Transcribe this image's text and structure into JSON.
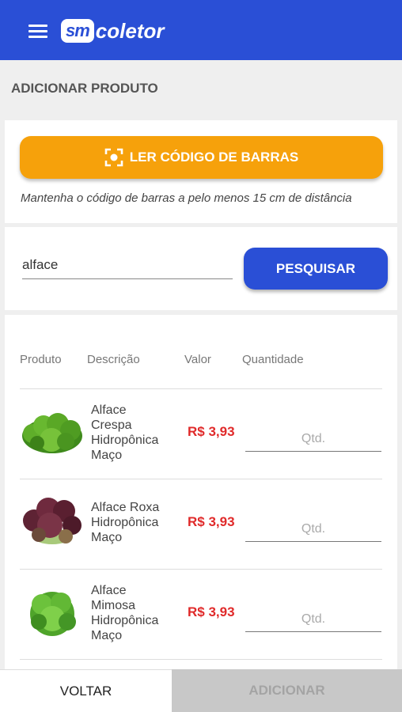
{
  "app_bar": {
    "logo_badge": "sm",
    "logo_text": "coletor",
    "menu_icon": "menu-icon"
  },
  "page_title": "ADICIONAR PRODUTO",
  "scan": {
    "button_label": "LER CÓDIGO DE BARRAS",
    "icon": "barcode-scan-icon",
    "hint": "Mantenha o código de barras a pelo menos 15 cm de distância"
  },
  "search": {
    "value": "alface",
    "button_label": "PESQUISAR"
  },
  "table": {
    "headers": {
      "product": "Produto",
      "description": "Descrição",
      "value": "Valor",
      "quantity": "Quantidade"
    },
    "rows": [
      {
        "description_lines": [
          "Alface",
          "Crespa",
          "Hidropônica",
          "Maço"
        ],
        "price": "R$ 3,93",
        "qty_placeholder": "Qtd."
      },
      {
        "description_lines": [
          "Alface Roxa",
          "Hidropônica",
          "Maço"
        ],
        "price": "R$ 3,93",
        "qty_placeholder": "Qtd."
      },
      {
        "description_lines": [
          "Alface",
          "Mimosa",
          "Hidropônica",
          "Maço"
        ],
        "price": "R$ 3,93",
        "qty_placeholder": "Qtd."
      }
    ]
  },
  "footer": {
    "back_label": "VOLTAR",
    "add_label": "ADICIONAR"
  },
  "colors": {
    "primary": "#2a4fd6",
    "accent": "#f6a10b",
    "price": "#e02a2a"
  }
}
